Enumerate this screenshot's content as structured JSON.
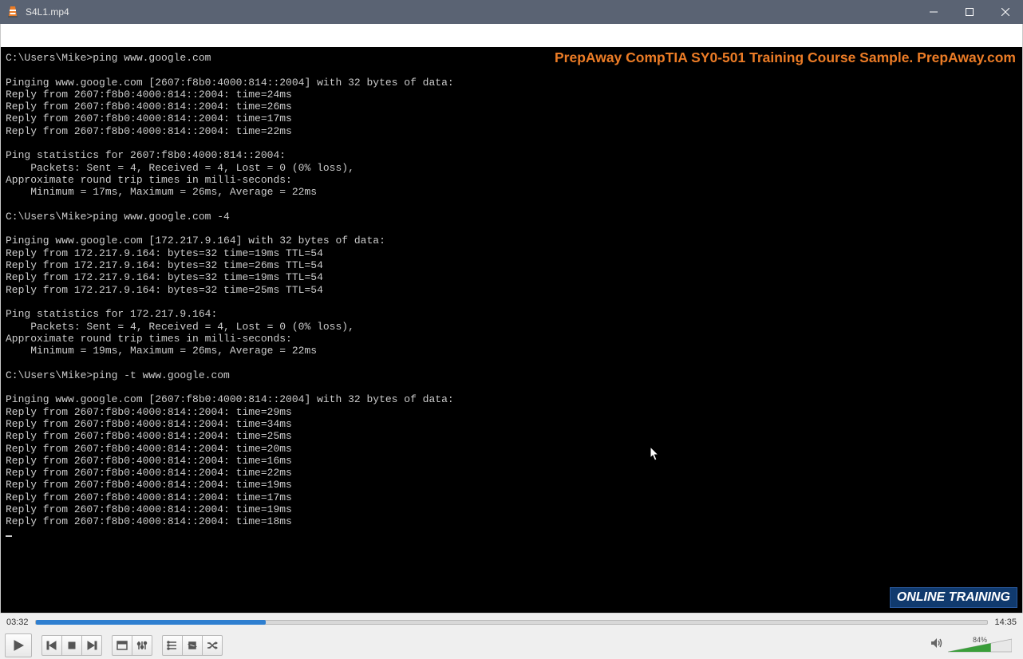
{
  "window": {
    "title": "S4L1.mp4"
  },
  "video": {
    "watermark": "PrepAway CompTIA SY0-501 Training Course Sample. PrepAway.com",
    "badge": "ONLINE TRAINING"
  },
  "terminal": {
    "lines": [
      "C:\\Users\\Mike>ping www.google.com",
      "",
      "Pinging www.google.com [2607:f8b0:4000:814::2004] with 32 bytes of data:",
      "Reply from 2607:f8b0:4000:814::2004: time=24ms",
      "Reply from 2607:f8b0:4000:814::2004: time=26ms",
      "Reply from 2607:f8b0:4000:814::2004: time=17ms",
      "Reply from 2607:f8b0:4000:814::2004: time=22ms",
      "",
      "Ping statistics for 2607:f8b0:4000:814::2004:",
      "    Packets: Sent = 4, Received = 4, Lost = 0 (0% loss),",
      "Approximate round trip times in milli-seconds:",
      "    Minimum = 17ms, Maximum = 26ms, Average = 22ms",
      "",
      "C:\\Users\\Mike>ping www.google.com -4",
      "",
      "Pinging www.google.com [172.217.9.164] with 32 bytes of data:",
      "Reply from 172.217.9.164: bytes=32 time=19ms TTL=54",
      "Reply from 172.217.9.164: bytes=32 time=26ms TTL=54",
      "Reply from 172.217.9.164: bytes=32 time=19ms TTL=54",
      "Reply from 172.217.9.164: bytes=32 time=25ms TTL=54",
      "",
      "Ping statistics for 172.217.9.164:",
      "    Packets: Sent = 4, Received = 4, Lost = 0 (0% loss),",
      "Approximate round trip times in milli-seconds:",
      "    Minimum = 19ms, Maximum = 26ms, Average = 22ms",
      "",
      "C:\\Users\\Mike>ping -t www.google.com",
      "",
      "Pinging www.google.com [2607:f8b0:4000:814::2004] with 32 bytes of data:",
      "Reply from 2607:f8b0:4000:814::2004: time=29ms",
      "Reply from 2607:f8b0:4000:814::2004: time=34ms",
      "Reply from 2607:f8b0:4000:814::2004: time=25ms",
      "Reply from 2607:f8b0:4000:814::2004: time=20ms",
      "Reply from 2607:f8b0:4000:814::2004: time=16ms",
      "Reply from 2607:f8b0:4000:814::2004: time=22ms",
      "Reply from 2607:f8b0:4000:814::2004: time=19ms",
      "Reply from 2607:f8b0:4000:814::2004: time=17ms",
      "Reply from 2607:f8b0:4000:814::2004: time=19ms",
      "Reply from 2607:f8b0:4000:814::2004: time=18ms"
    ]
  },
  "player": {
    "elapsed": "03:32",
    "total": "14:35",
    "progress_percent": 24.2,
    "volume_percent": 84,
    "volume_label": "84%"
  }
}
